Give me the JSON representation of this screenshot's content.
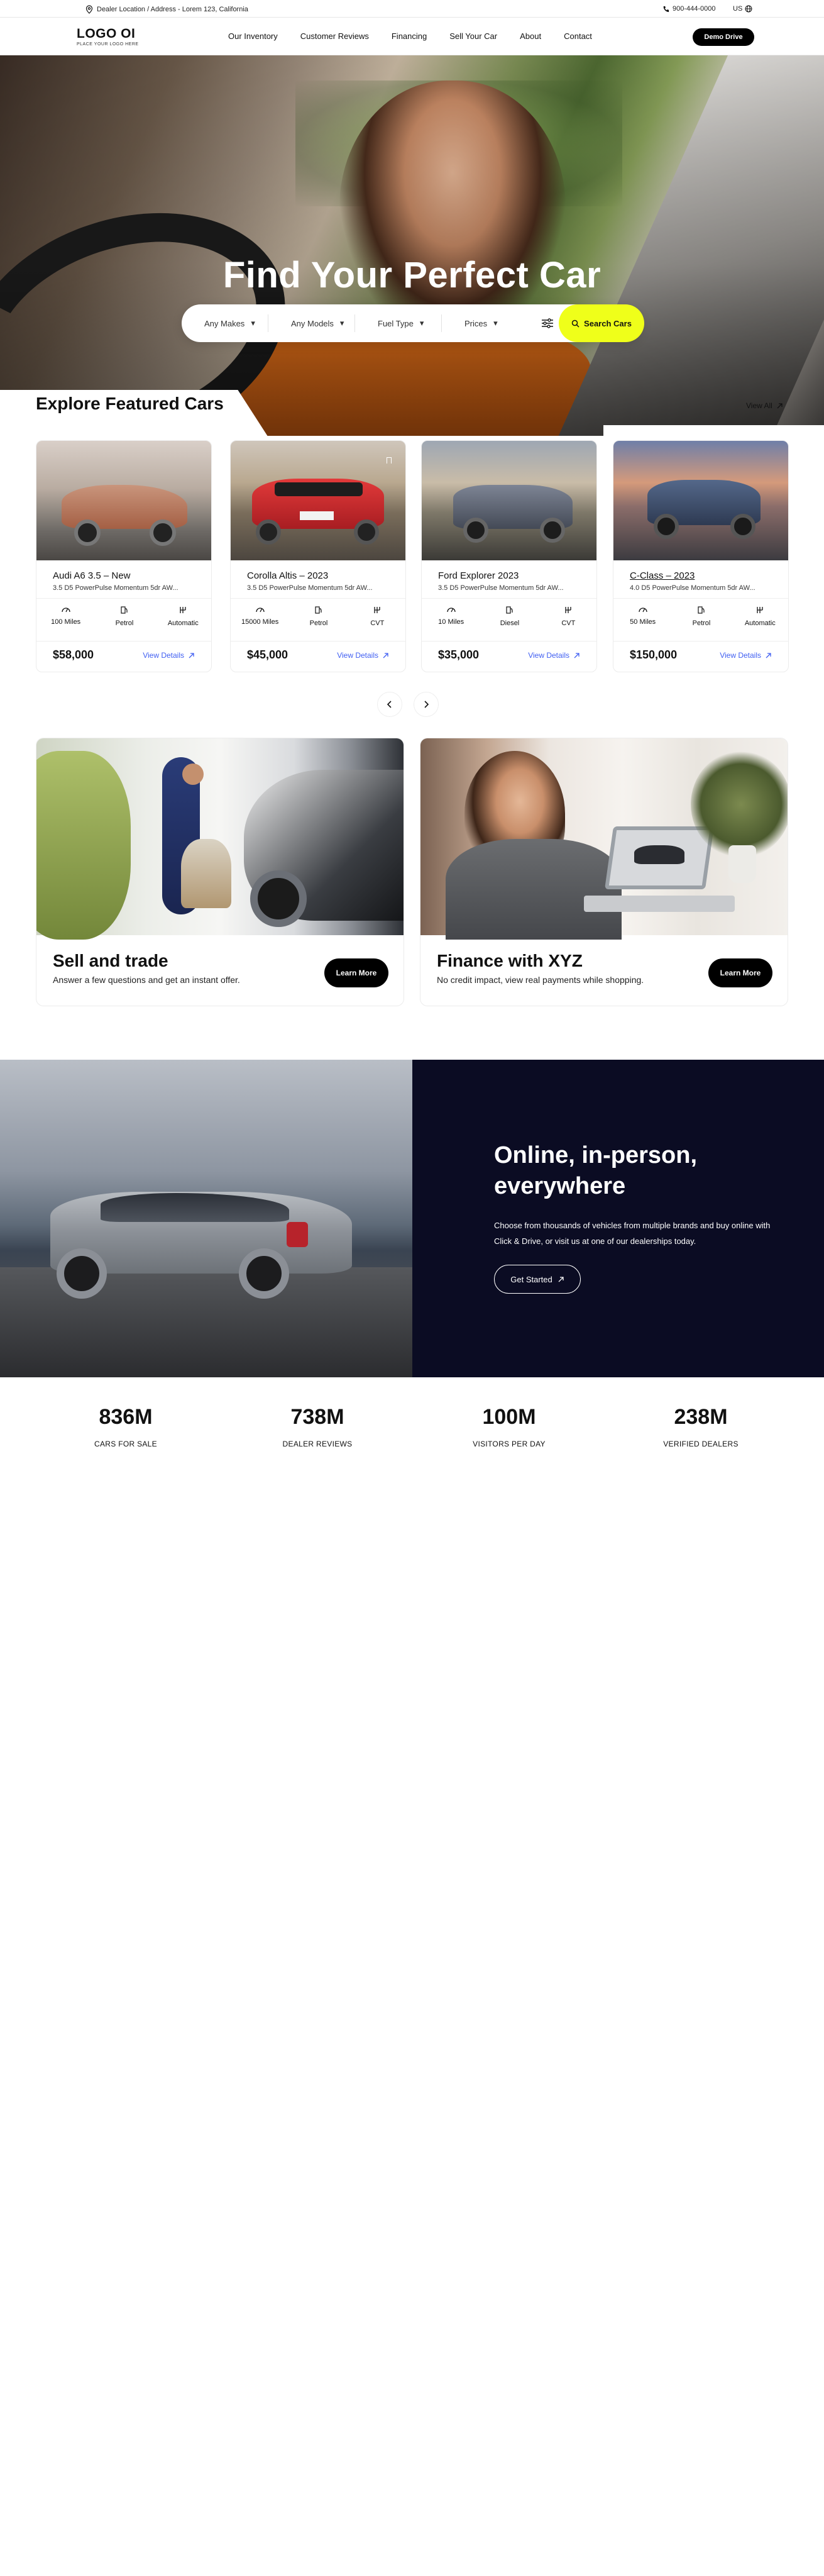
{
  "topbar": {
    "location": "Dealer Location / Address - Lorem 123, California",
    "phone": "900-444-0000",
    "language": "US"
  },
  "header": {
    "logo_main": "LOGO OI",
    "logo_tagline": "PLACE YOUR LOGO HERE",
    "menu": [
      "Our Inventory",
      "Customer Reviews",
      "Financing",
      "Sell Your Car",
      "About",
      "Contact"
    ],
    "demo_button": "Demo Drive"
  },
  "hero": {
    "title": "Find Your Perfect Car",
    "filters": [
      "Any Makes",
      "Any Models",
      "Fuel Type",
      "Prices"
    ],
    "search_button": "Search Cars"
  },
  "featured": {
    "title": "Explore Featured Cars",
    "view_all": "View All",
    "cars": [
      {
        "name": "Audi A6 3.5 – New",
        "engine": "3.5 D5 PowerPulse Momentum 5dr AW...",
        "mileage": "100 Miles",
        "fuel": "Petrol",
        "transmission": "Automatic",
        "price": "$58,000",
        "details": "View Details",
        "color": "#b06a4d"
      },
      {
        "name": "Corolla Altis – 2023",
        "engine": "3.5 D5 PowerPulse Momentum 5dr AW...",
        "mileage": "15000 Miles",
        "fuel": "Petrol",
        "transmission": "CVT",
        "price": "$45,000",
        "details": "View Details",
        "color": "#d8262c"
      },
      {
        "name": "Ford Explorer 2023",
        "engine": "3.5 D5 PowerPulse Momentum 5dr AW...",
        "mileage": "10 Miles",
        "fuel": "Diesel",
        "transmission": "CVT",
        "price": "$35,000",
        "details": "View Details",
        "color": "#5a6170"
      },
      {
        "name": "C-Class – 2023",
        "engine": "4.0 D5 PowerPulse Momentum 5dr AW...",
        "mileage": "50 Miles",
        "fuel": "Petrol",
        "transmission": "Automatic",
        "price": "$150,000",
        "details": "View Details",
        "color": "#3b4c66"
      }
    ]
  },
  "promos": [
    {
      "title": "Sell and trade",
      "text": "Answer a few questions and get an instant offer.",
      "button": "Learn More"
    },
    {
      "title": "Finance with XYZ",
      "text": "No credit impact, view real payments while shopping.",
      "button": "Learn More"
    }
  ],
  "band": {
    "title": "Online, in-person, everywhere",
    "text": "Choose from thousands of vehicles from multiple brands and buy online with Click & Drive, or visit us at one of our dealerships today.",
    "button": "Get Started"
  },
  "stats": [
    {
      "value": "836M",
      "label": "CARS FOR SALE"
    },
    {
      "value": "738M",
      "label": "DEALER REVIEWS"
    },
    {
      "value": "100M",
      "label": "VISITORS PER DAY"
    },
    {
      "value": "238M",
      "label": "VERIFIED DEALERS"
    }
  ],
  "colors": {
    "accent_yellow": "#efff1a",
    "link_blue": "#405ff2",
    "dark_navy": "#0b0c23"
  }
}
